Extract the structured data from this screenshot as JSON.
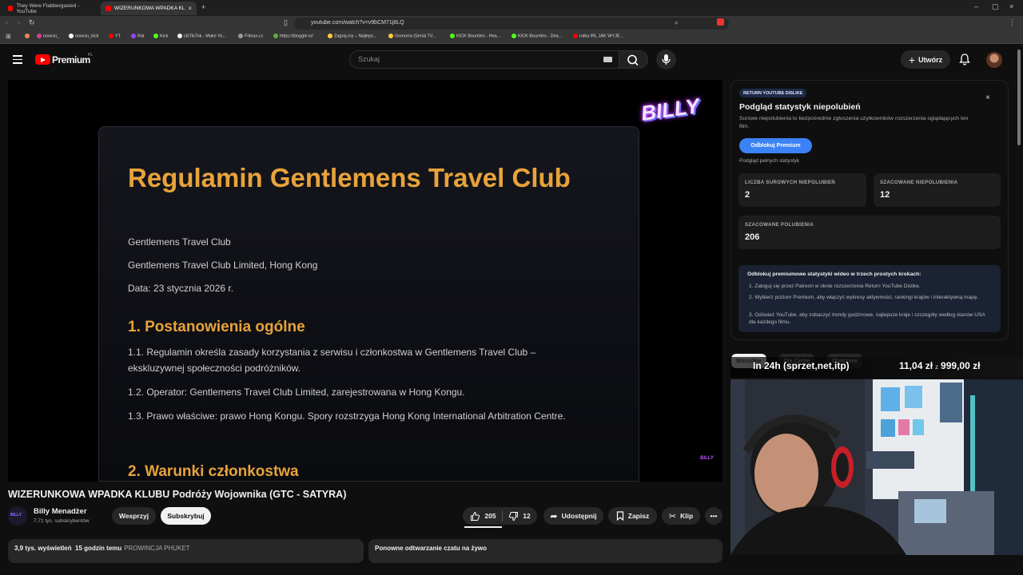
{
  "browser": {
    "tabs": [
      {
        "title": "They Were Flabbergasted - YouTube"
      },
      {
        "title": "WIZERUNKOWA WPADKA KL"
      }
    ],
    "url": "youtube.com/watch?v=v9bCM71j8LQ",
    "bookmarks": [
      "nowciu_",
      "nowciu_kick",
      "YT",
      "Rat",
      "Kick",
      "(4)TikTok - Make Yo...",
      "Filman.cc",
      "https://tanggle.io/",
      "Zagraj.my – Najleps...",
      "Gomorra (Serial TV...",
      "KICK Bounties - Hea...",
      "KICK Bounties - Dea...",
      "rutka IRL JAK WYJE..."
    ]
  },
  "header": {
    "brand": "Premium",
    "region": "PL",
    "search_placeholder": "Szukaj",
    "create_label": "Utwórz"
  },
  "slide": {
    "title": "Regulamin Gentlemens Travel Club",
    "lines": [
      "Gentlemens Travel Club",
      "Gentlemens Travel Club Limited, Hong Kong",
      "Data: 23 stycznia 2026 r."
    ],
    "section1": "1. Postanowienia ogólne",
    "p11": "1.1. Regulamin określa zasady korzystania z serwisu i członkostwa w Gentlemens Travel Club – ekskluzywnej społeczności podróżników.",
    "p12": "1.2. Operator: Gentlemens Travel Club Limited, zarejestrowana w Hong Kongu.",
    "p13": "1.3. Prawo właściwe: prawo Hong Kongu. Spory rozstrzyga Hong Kong International Arbitration Centre.",
    "section2": "2. Warunki członkostwa",
    "watermark": "BILLY",
    "watermark_small": "BILLY"
  },
  "video": {
    "title": "WIZERUNKOWA WPADKA KLUBU Podróży Wojownika (GTC - SATYRA)",
    "channel": "Billy Menadżer",
    "channel_avatar_text": "BILLY",
    "subscribers": "7,71 tys. subskrybentów",
    "support_label": "Wesprzyj",
    "subscribe_label": "Subskrybuj",
    "likes": "205",
    "dislikes": "12",
    "share_label": "Udostępnij",
    "save_label": "Zapisz",
    "clip_label": "Klip",
    "views": "3,9 tys. wyświetleń",
    "age": "15 godzin temu",
    "tag": "PROWINCJA PHUKET",
    "chat_replay": "Ponowne odtwarzanie czatu na żywo"
  },
  "ryd": {
    "badge": "RETURN YOUTUBE DISLIKE",
    "title": "Podgląd statystyk niepolubień",
    "subtitle": "Surowe niepolubienia to bezpośrednie zgłoszenia użytkowników rozszerzenia oglądających ten film.",
    "unlock_label": "Odblokuj Premium",
    "preview_label": "Podgląd pełnych statystyk",
    "raw_label": "LICZBA SUROWYCH NIEPOLUBIEŃ",
    "raw_value": "2",
    "est_dislikes_label": "SZACOWANE NIEPOLUBIENIA",
    "est_dislikes_value": "12",
    "est_likes_label": "SZACOWANE POLUBIENIA",
    "est_likes_value": "206",
    "steps_title": "Odblokuj premiumowe statystyki wideo w trzech prostych krokach:",
    "steps": [
      "1.  Zaloguj się przez Patreon w oknie rozszerzenia Return YouTube Dislike.",
      "2.  Wybierz poziom Premium, aby włączyć wykresy aktywności, rankingi krajów i interaktywną mapę.",
      "3.  Odśwież YouTube, aby zobaczyć trendy godzinowe, najlepsze kraje i szczegóły według stanów USA dla każdego filmu."
    ]
  },
  "sidebar": {
    "chips": [
      "Wszystkie",
      "Dla Ciebie",
      "Obejrzane"
    ]
  },
  "stream_overlay": {
    "left": "In 24h (sprzet,net,itp)",
    "current": "11,04 zł",
    "separator": "z",
    "goal": "999,00 zł"
  }
}
